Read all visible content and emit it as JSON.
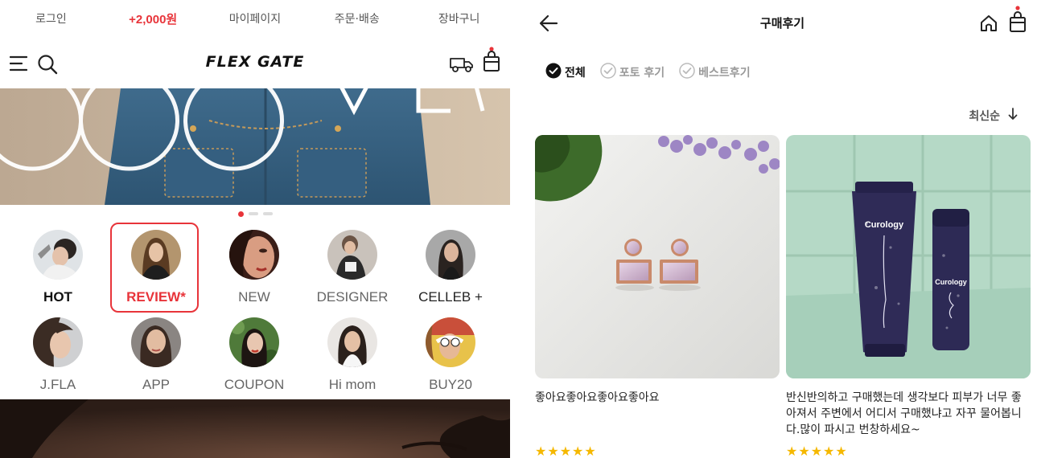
{
  "left": {
    "util_bar": [
      {
        "label": "로그인"
      },
      {
        "label": "+2,000원"
      },
      {
        "label": "마이페이지"
      },
      {
        "label": "주문·배송"
      },
      {
        "label": "장바구니"
      }
    ],
    "logo": "FLEX GATE",
    "categories": [
      {
        "label": "HOT"
      },
      {
        "label": "REVIEW*"
      },
      {
        "label": "NEW"
      },
      {
        "label": "DESIGNER"
      },
      {
        "label": "CELLEB +"
      },
      {
        "label": "J.FLA"
      },
      {
        "label": "APP"
      },
      {
        "label": "COUPON"
      },
      {
        "label": "Hi mom"
      },
      {
        "label": "BUY20"
      }
    ]
  },
  "right": {
    "title": "구매후기",
    "filters": [
      {
        "label": "전체",
        "active": true
      },
      {
        "label": "포토 후기",
        "active": false
      },
      {
        "label": "베스트후기",
        "active": false
      }
    ],
    "sort": {
      "label": "최신순"
    },
    "reviews": [
      {
        "text": "좋아요좋아요좋아요좋아요",
        "rating": 5
      },
      {
        "text": "반신반의하고 구매했는데 생각보다 피부가 너무 좋아져서 주변에서 어디서 구매했냐고 자꾸 물어봅니다.많이 파시고 번창하세요~",
        "rating": 5
      }
    ],
    "product_brand": "Curology"
  },
  "colors": {
    "accent": "#e8343a",
    "star": "#f5b800"
  }
}
